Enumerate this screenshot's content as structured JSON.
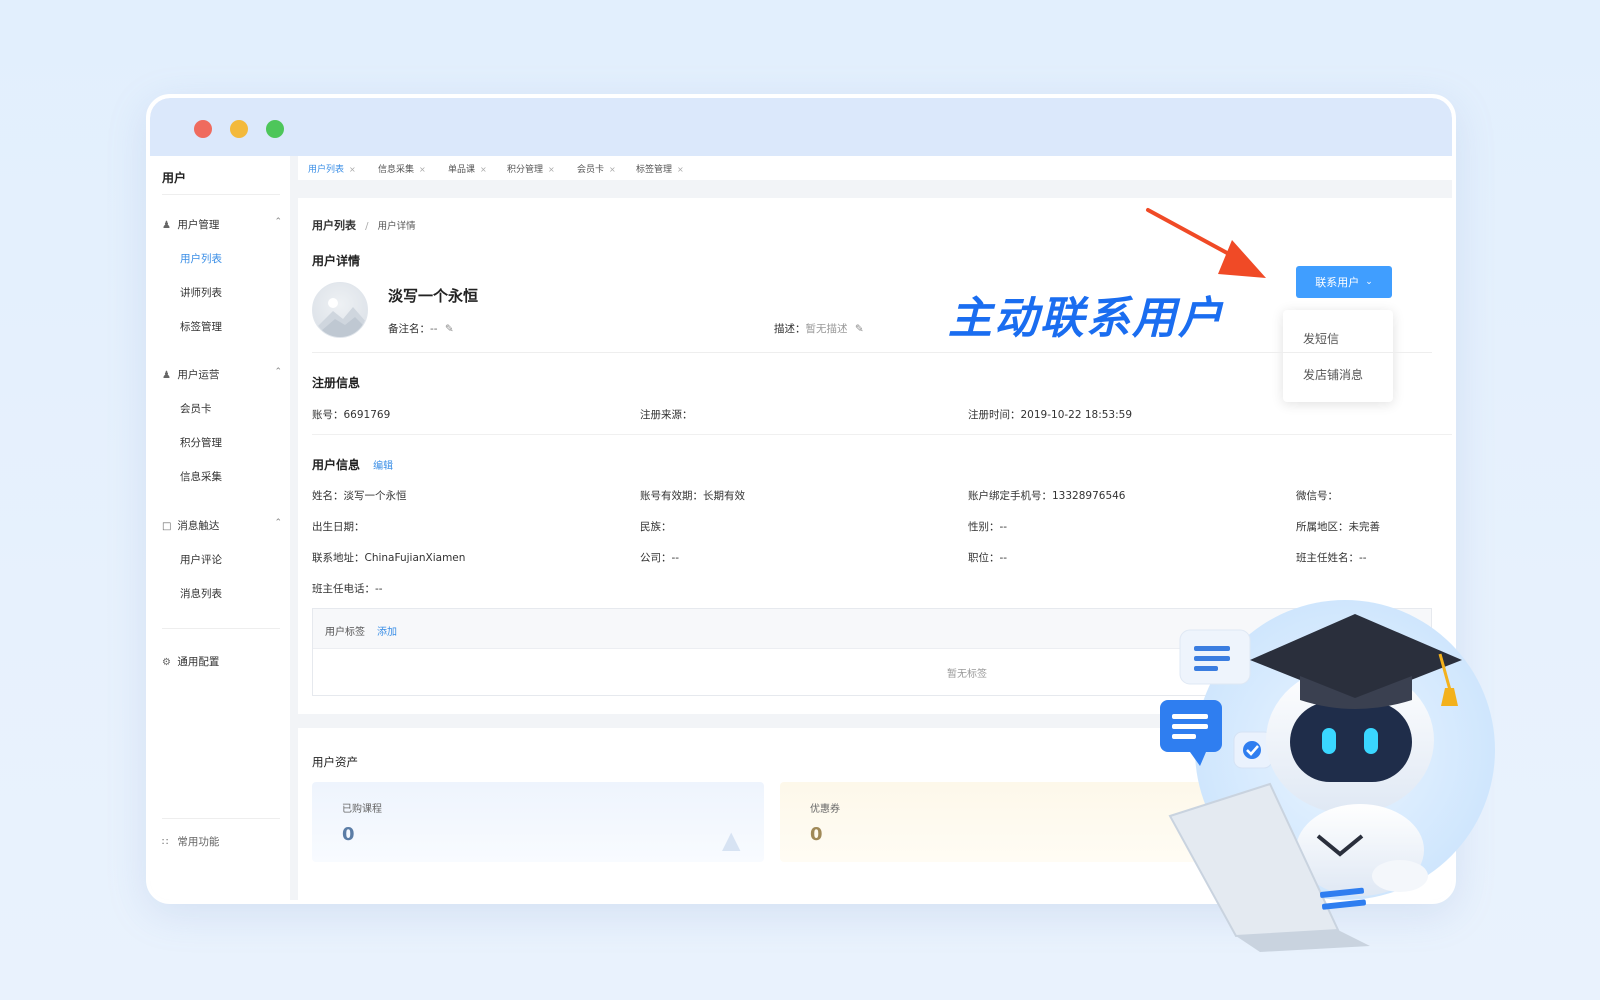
{
  "sidebar": {
    "title": "用户",
    "groups": [
      {
        "label": "用户管理",
        "items": [
          "用户列表",
          "讲师列表",
          "标签管理"
        ]
      },
      {
        "label": "用户运营",
        "items": [
          "会员卡",
          "积分管理",
          "信息采集"
        ]
      },
      {
        "label": "消息触达",
        "items": [
          "用户评论",
          "消息列表"
        ]
      }
    ],
    "general_config": "通用配置",
    "common_functions": "常用功能"
  },
  "tabs": [
    "用户列表",
    "信息采集",
    "单品课",
    "积分管理",
    "会员卡",
    "标签管理"
  ],
  "breadcrumb": {
    "parent": "用户列表",
    "separator": "/",
    "current": "用户详情"
  },
  "detail": {
    "section_title": "用户详情",
    "username": "淡写一个永恒",
    "remark_label": "备注名：",
    "remark_value": "--",
    "desc_label": "描述：",
    "desc_value": "暂无描述"
  },
  "contact": {
    "button_label": "联系用户",
    "options": [
      "发短信",
      "发店铺消息"
    ]
  },
  "callout_text": "主动联系用户",
  "registration": {
    "title": "注册信息",
    "account": "账号：6691769",
    "source": "注册来源：",
    "time": "注册时间：2019-10-22 18:53:59"
  },
  "user_info": {
    "title": "用户信息",
    "edit_label": "编辑",
    "rows": [
      [
        "姓名：淡写一个永恒",
        "账号有效期：长期有效",
        "账户绑定手机号：13328976546",
        "微信号："
      ],
      [
        "出生日期：",
        "民族：",
        "性别：--",
        "所属地区：未完善"
      ],
      [
        "联系地址：ChinaFujianXiamen",
        "公司：--",
        "职位：--",
        "班主任姓名：--"
      ],
      [
        "班主任电话：--"
      ]
    ]
  },
  "tags": {
    "title": "用户标签",
    "add_label": "添加",
    "empty": "暂无标签"
  },
  "assets": {
    "title": "用户资产",
    "cards": [
      {
        "label": "已购课程",
        "value": "0"
      },
      {
        "label": "优惠券",
        "value": "0"
      }
    ]
  },
  "colors": {
    "accent": "#409eff",
    "callout": "#1a6df0",
    "arrow": "#f04a26"
  }
}
